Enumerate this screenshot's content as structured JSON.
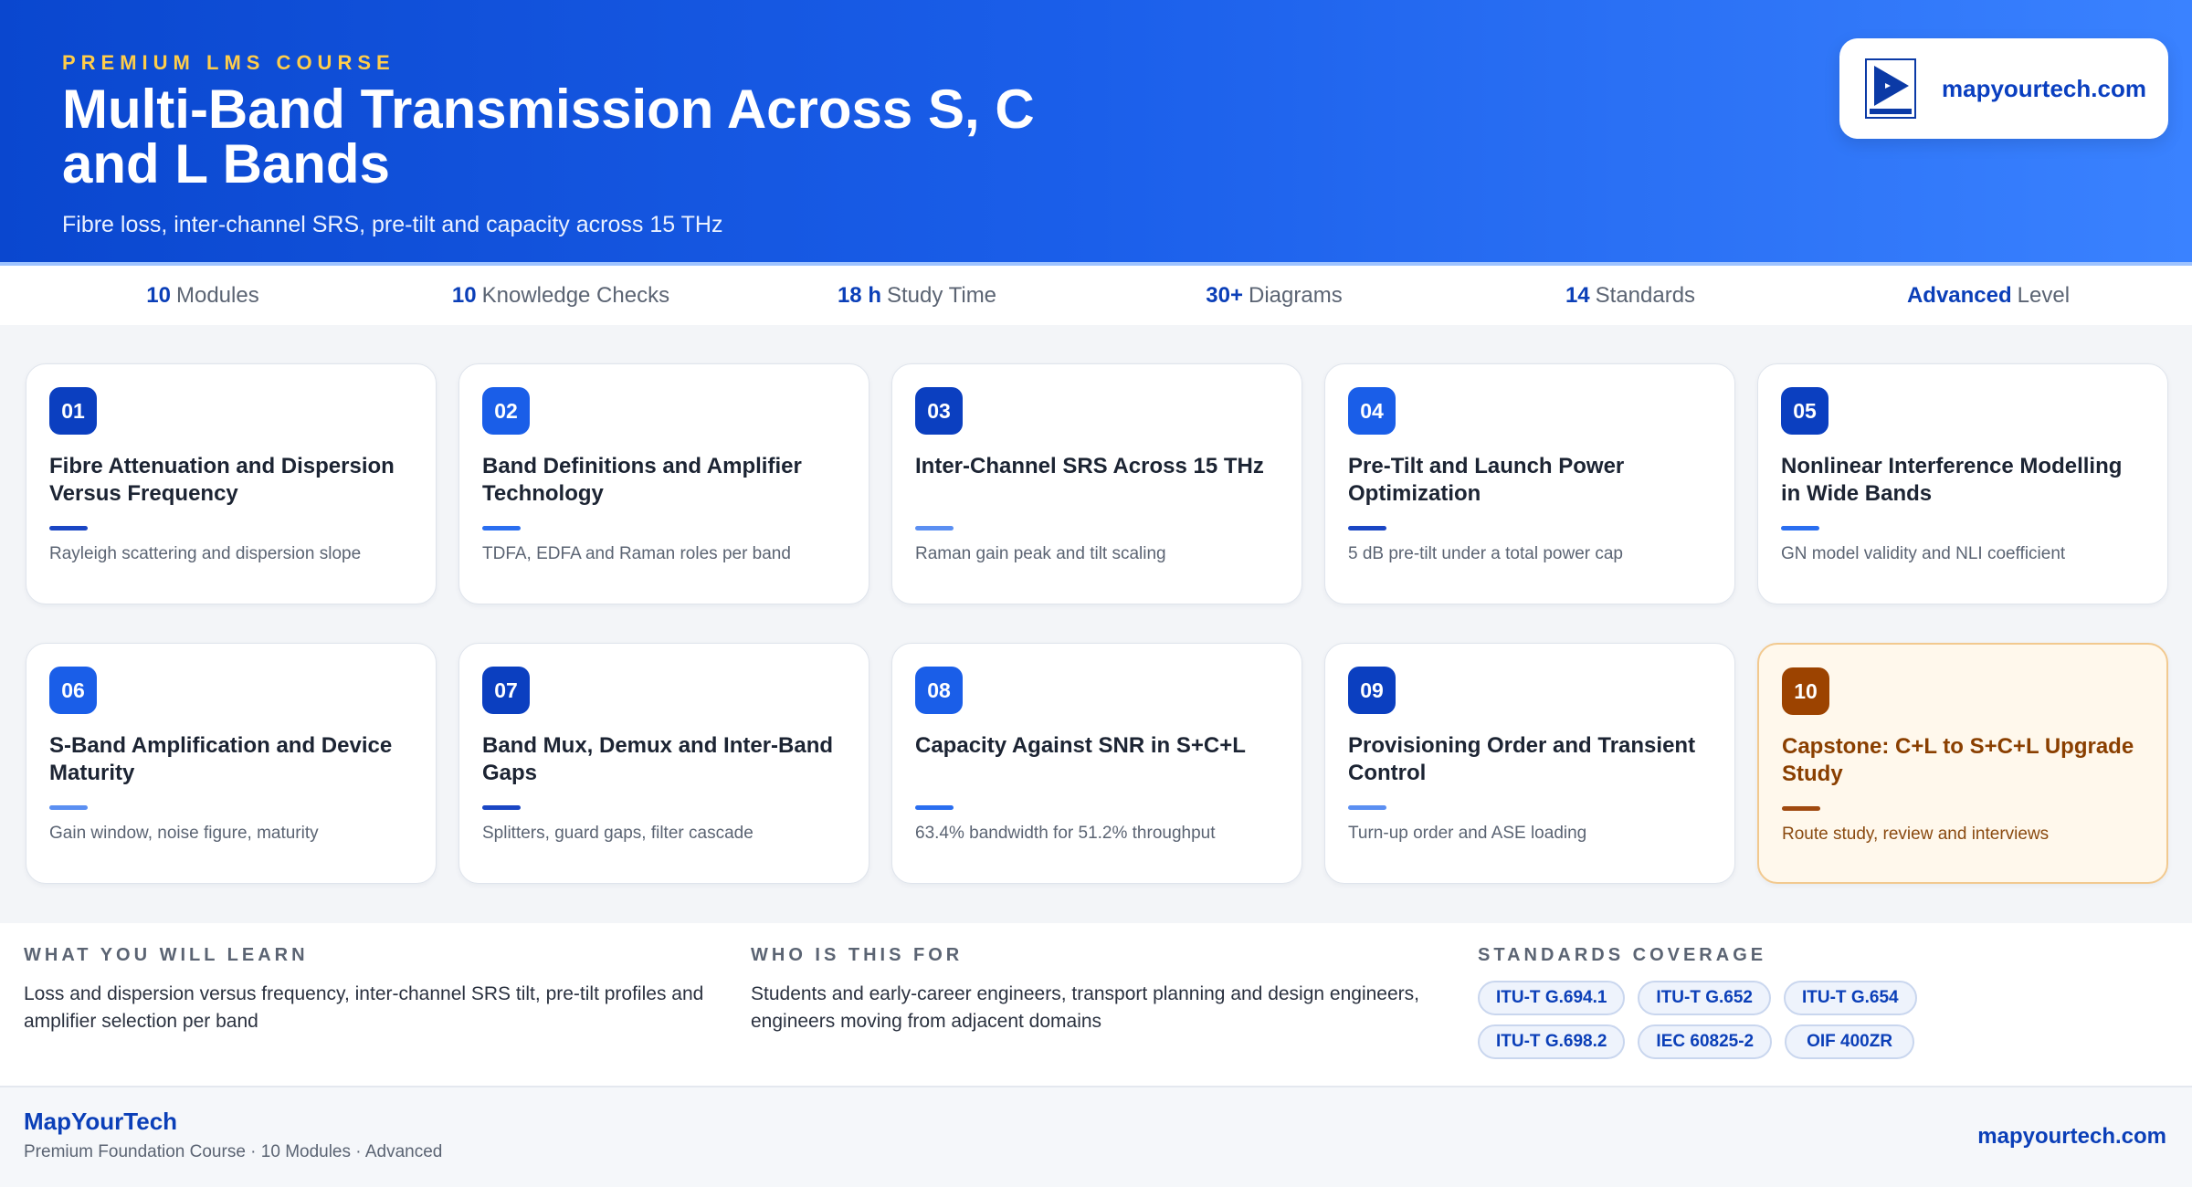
{
  "header": {
    "eyebrow": "PREMIUM LMS COURSE",
    "title": "Multi-Band Transmission Across S, C and L Bands",
    "subtitle": "Fibre loss, inter-channel SRS, pre-tilt and capacity across 15 THz",
    "brand_url": "mapyourtech.com",
    "colors": {
      "gradient_start": "#0a47cf",
      "gradient_end": "#3a82ff",
      "eyebrow": "#ffcd4a"
    }
  },
  "stats": [
    {
      "num": "10",
      "label": "Modules"
    },
    {
      "num": "10",
      "label": "Knowledge Checks"
    },
    {
      "num": "18 h",
      "label": "Study Time"
    },
    {
      "num": "30+",
      "label": "Diagrams"
    },
    {
      "num": "14",
      "label": "Standards"
    },
    {
      "num": "Advanced",
      "label": "Level"
    }
  ],
  "modules": [
    {
      "num": "01",
      "title": "Fibre Attenuation and Dispersion Versus Frequency",
      "subtitle": "Rayleigh scattering and dispersion slope",
      "badge_color": "#0b3fc0",
      "rule_color": "#1a46c4"
    },
    {
      "num": "02",
      "title": "Band Definitions and Amplifier Technology",
      "subtitle": "TDFA, EDFA and Raman roles per band",
      "badge_color": "#1a5ee8",
      "rule_color": "#2a6ef0"
    },
    {
      "num": "03",
      "title": "Inter-Channel SRS Across 15 THz",
      "subtitle": "Raman gain peak and tilt scaling",
      "badge_color": "#0b3fc0",
      "rule_color": "#5b8ff2"
    },
    {
      "num": "04",
      "title": "Pre-Tilt and Launch Power Optimization",
      "subtitle": "5 dB pre-tilt under a total power cap",
      "badge_color": "#1a5ee8",
      "rule_color": "#1a46c4"
    },
    {
      "num": "05",
      "title": "Nonlinear Interference Modelling in Wide Bands",
      "subtitle": "GN model validity and NLI coefficient",
      "badge_color": "#0b3fc0",
      "rule_color": "#2a6ef0"
    },
    {
      "num": "06",
      "title": "S-Band Amplification and Device Maturity",
      "subtitle": "Gain window, noise figure, maturity",
      "badge_color": "#1a5ee8",
      "rule_color": "#5b8ff2"
    },
    {
      "num": "07",
      "title": "Band Mux, Demux and Inter-Band Gaps",
      "subtitle": "Splitters, guard gaps, filter cascade",
      "badge_color": "#0b3fc0",
      "rule_color": "#1a46c4"
    },
    {
      "num": "08",
      "title": "Capacity Against SNR in S+C+L",
      "subtitle": "63.4% bandwidth for 51.2% throughput",
      "badge_color": "#1a5ee8",
      "rule_color": "#2a6ef0"
    },
    {
      "num": "09",
      "title": "Provisioning Order and Transient Control",
      "subtitle": "Turn-up order and ASE loading",
      "badge_color": "#0b3fc0",
      "rule_color": "#5b8ff2"
    },
    {
      "num": "10",
      "title": "Capstone: C+L to S+C+L Upgrade Study",
      "subtitle": "Route study, review and interviews",
      "badge_color": "#9c4300",
      "rule_color": "#a04a10",
      "accent": true
    }
  ],
  "info": {
    "learn_heading": "WHAT YOU WILL LEARN",
    "learn_text": "Loss and dispersion versus frequency, inter-channel SRS tilt, pre-tilt profiles and amplifier selection per band",
    "audience_heading": "WHO IS THIS FOR",
    "audience_text": "Students and early-career engineers, transport planning and design engineers, engineers moving from adjacent domains",
    "standards_heading": "STANDARDS COVERAGE",
    "standards": [
      "ITU-T G.694.1",
      "ITU-T G.652",
      "ITU-T G.654",
      "ITU-T G.698.2",
      "IEC 60825-2",
      "OIF 400ZR"
    ]
  },
  "footer": {
    "brand": "MapYourTech",
    "meta": "Premium Foundation Course · 10 Modules · Advanced",
    "url": "mapyourtech.com"
  }
}
